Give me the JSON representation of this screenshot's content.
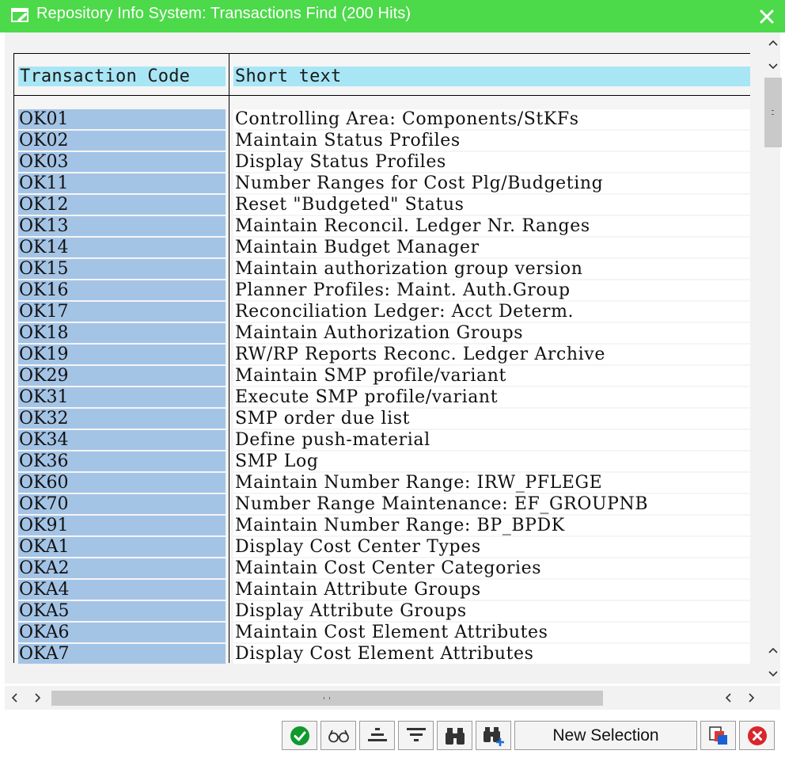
{
  "window": {
    "title": "Repository Info System: Transactions Find (200 Hits)",
    "icon": "dialog-icon",
    "close": "close-icon"
  },
  "table": {
    "headers": [
      "Transaction Code",
      "Short text"
    ],
    "rows": [
      {
        "code": "OK01",
        "text": "Controlling Area: Components/StKFs"
      },
      {
        "code": "OK02",
        "text": "Maintain Status Profiles"
      },
      {
        "code": "OK03",
        "text": "Display Status Profiles"
      },
      {
        "code": "OK11",
        "text": "Number Ranges for Cost Plg/Budgeting"
      },
      {
        "code": "OK12",
        "text": "Reset \"Budgeted\" Status"
      },
      {
        "code": "OK13",
        "text": "Maintain Reconcil. Ledger Nr. Ranges"
      },
      {
        "code": "OK14",
        "text": "Maintain Budget Manager"
      },
      {
        "code": "OK15",
        "text": "Maintain authorization group version"
      },
      {
        "code": "OK16",
        "text": "Planner Profiles: Maint. Auth.Group"
      },
      {
        "code": "OK17",
        "text": "Reconciliation Ledger: Acct Determ."
      },
      {
        "code": "OK18",
        "text": "Maintain Authorization Groups"
      },
      {
        "code": "OK19",
        "text": "RW/RP Reports Reconc. Ledger Archive"
      },
      {
        "code": "OK29",
        "text": "Maintain SMP profile/variant"
      },
      {
        "code": "OK31",
        "text": "Execute SMP profile/variant"
      },
      {
        "code": "OK32",
        "text": "SMP order due list"
      },
      {
        "code": "OK34",
        "text": "Define push-material"
      },
      {
        "code": "OK36",
        "text": "SMP Log"
      },
      {
        "code": "OK60",
        "text": "Maintain Number Range: IRW_PFLEGE"
      },
      {
        "code": "OK70",
        "text": "Number Range Maintenance: EF_GROUPNB"
      },
      {
        "code": "OK91",
        "text": "Maintain Number Range: BP_BPDK"
      },
      {
        "code": "OKA1",
        "text": "Display Cost Center Types"
      },
      {
        "code": "OKA2",
        "text": "Maintain Cost Center Categories"
      },
      {
        "code": "OKA4",
        "text": "Maintain Attribute Groups"
      },
      {
        "code": "OKA5",
        "text": "Display Attribute Groups"
      },
      {
        "code": "OKA6",
        "text": "Maintain Cost Element Attributes"
      },
      {
        "code": "OKA7",
        "text": "Display Cost Element Attributes"
      }
    ]
  },
  "toolbar": {
    "new_selection_label": "New Selection",
    "icons": [
      "checkmark-icon",
      "glasses-icon",
      "align-center-icon",
      "filter-icon",
      "binoculars-icon",
      "binoculars-plus-icon",
      "multiple-windows-icon",
      "cancel-icon"
    ]
  },
  "colors": {
    "titlebar": "#4cd94a",
    "header_cell": "#a8e6f5",
    "code_cell": "#a4c4e6",
    "confirm": "#0f9a2e",
    "cancel": "#d9262c"
  }
}
